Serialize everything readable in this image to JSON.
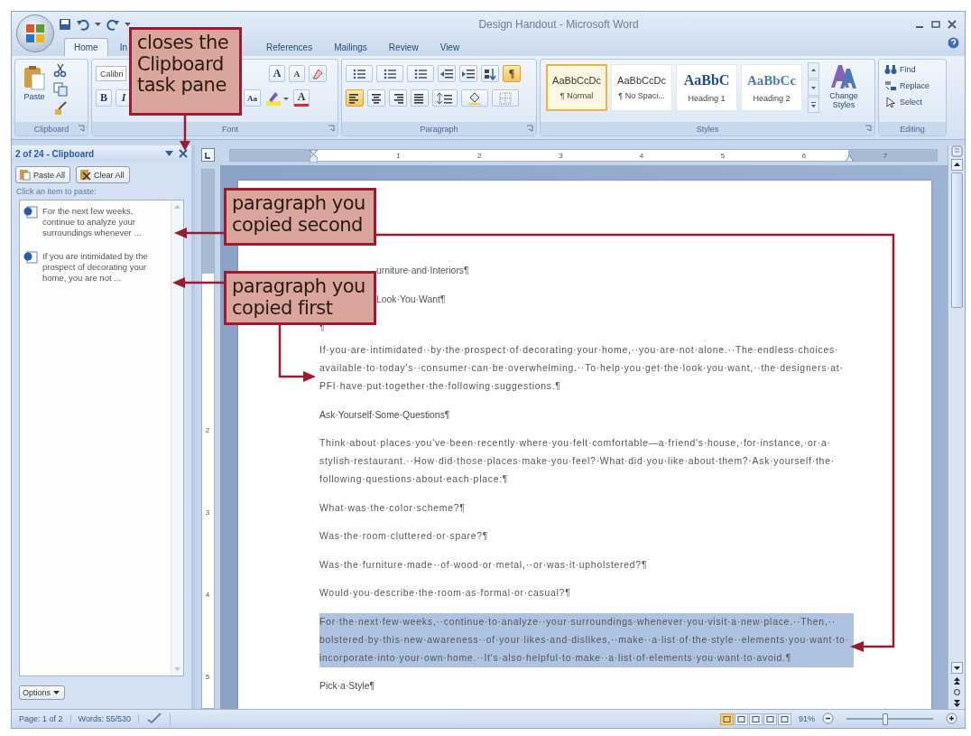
{
  "window": {
    "title": "Design Handout - Microsoft Word"
  },
  "tabs": [
    {
      "label": "Home",
      "selected": true
    },
    {
      "label": "In",
      "selected": false
    },
    {
      "label": "References",
      "selected": false
    },
    {
      "label": "Mailings",
      "selected": false
    },
    {
      "label": "Review",
      "selected": false
    },
    {
      "label": "View",
      "selected": false
    }
  ],
  "ribbon": {
    "clipboard": {
      "label": "Clipboard",
      "paste": "Paste"
    },
    "font": {
      "label": "Font",
      "font_name": "Calibri",
      "grow": "A",
      "shrink": "A",
      "bold": "B",
      "italic": "I",
      "change_case": "Aa",
      "font_color": "A"
    },
    "paragraph": {
      "label": "Paragraph",
      "show_marks": {
        "label": "¶",
        "on": true
      },
      "alignment": [
        {
          "kind": "left",
          "selected": true
        },
        {
          "kind": "center",
          "selected": false
        },
        {
          "kind": "right",
          "selected": false
        },
        {
          "kind": "justify",
          "selected": false
        }
      ]
    },
    "styles": {
      "label": "Styles",
      "gallery": [
        {
          "sample": "AaBbCcDc",
          "name": "¶ Normal",
          "kind": "body",
          "selected": true
        },
        {
          "sample": "AaBbCcDc",
          "name": "¶ No Spaci...",
          "kind": "body",
          "selected": false
        },
        {
          "sample": "AaBbC",
          "name": "Heading 1",
          "kind": "heading1",
          "selected": false
        },
        {
          "sample": "AaBbCc",
          "name": "Heading 2",
          "kind": "heading2",
          "selected": false
        }
      ],
      "change_styles": "Change Styles"
    },
    "editing": {
      "label": "Editing",
      "commands": [
        {
          "kind": "find",
          "label": "Find"
        },
        {
          "kind": "replace",
          "label": "Replace"
        },
        {
          "kind": "select",
          "label": "Select"
        }
      ]
    }
  },
  "clipboard_pane": {
    "title": "2 of 24 - Clipboard",
    "buttons": [
      {
        "kind": "paste",
        "label": "Paste All"
      },
      {
        "kind": "clear",
        "label": "Clear All"
      }
    ],
    "hint": "Click an item to paste:",
    "items": [
      {
        "text": "For the next few weeks, continue to analyze your surroundings whenever ..."
      },
      {
        "text": "If you are intimidated by the prospect of decorating your home, you are not ..."
      }
    ],
    "options": "Options"
  },
  "ruler": {
    "numbers": [
      "1",
      "2",
      "3",
      "4",
      "5",
      "6",
      "7"
    ]
  },
  "vertical_ruler": {
    "numbers": [
      "2",
      "3",
      "4",
      "5"
    ]
  },
  "document": {
    "paragraphs": [
      {
        "text": "urniture·and·Interiors¶",
        "kind": "covered",
        "selected": false
      },
      {
        "text": "Look·You·Want¶",
        "kind": "covered",
        "selected": false
      },
      {
        "text": "¶",
        "kind": "blank",
        "selected": false
      },
      {
        "text": "If·you·are·intimidated··by·the·prospect·of·decorating·your·home,··you·are·not·alone.··The·endless·choices·available·to·today's··consumer·can·be·overwhelming.··To·help·you·get·the·look·you·want,··the·designers·at·PFI·have·put·together·the·following·suggestions.¶",
        "kind": "body",
        "selected": false
      },
      {
        "text": "Ask·Yourself·Some·Questions¶",
        "kind": "heading",
        "selected": false
      },
      {
        "text": "Think·about·places·you've·been·recently·where·you·felt·comfortable—a·friend's·house,·for·instance,·or·a·stylish·restaurant.··How·did·those·places·make·you·feel?·What·did·you·like·about·them?·Ask·yourself·the·following·questions·about·each·place:¶",
        "kind": "body",
        "selected": false
      },
      {
        "text": "What·was·the·color·scheme?¶",
        "kind": "body",
        "selected": false
      },
      {
        "text": "Was·the·room·cluttered·or·spare?¶",
        "kind": "body",
        "selected": false
      },
      {
        "text": "Was·the·furniture·made··of·wood·or·metal,··or·was·it·upholstered?¶",
        "kind": "body",
        "selected": false
      },
      {
        "text": "Would·you·describe·the·room·as·formal·or·casual?¶",
        "kind": "body",
        "selected": false
      },
      {
        "text": "For·the·next·few·weeks,··continue·to·analyze··your·surroundings·whenever·you·visit·a·new·place.··Then,··bolstered·by·this·new·awareness··of·your·likes·and·dislikes,··make··a·list·of·the·style··elements·you·want·to·incorporate·into·your·own·home.··It's·also·helpful·to·make··a·list·of·elements·you·want·to·avoid.¶",
        "kind": "body",
        "selected": true
      },
      {
        "text": "Pick·a·Style¶",
        "kind": "heading",
        "selected": false
      }
    ]
  },
  "status_bar": {
    "page": "Page: 1 of 2",
    "words": "Words: 55/530",
    "views": [
      {
        "selected": true
      },
      {
        "selected": false
      },
      {
        "selected": false
      },
      {
        "selected": false
      },
      {
        "selected": false
      }
    ],
    "zoom": "91%",
    "zoom_slider": {
      "level": 0.45
    }
  },
  "callouts": [
    {
      "text": "closes the Clipboard task pane"
    },
    {
      "text": "paragraph you copied second"
    },
    {
      "text": "paragraph you copied first"
    }
  ]
}
